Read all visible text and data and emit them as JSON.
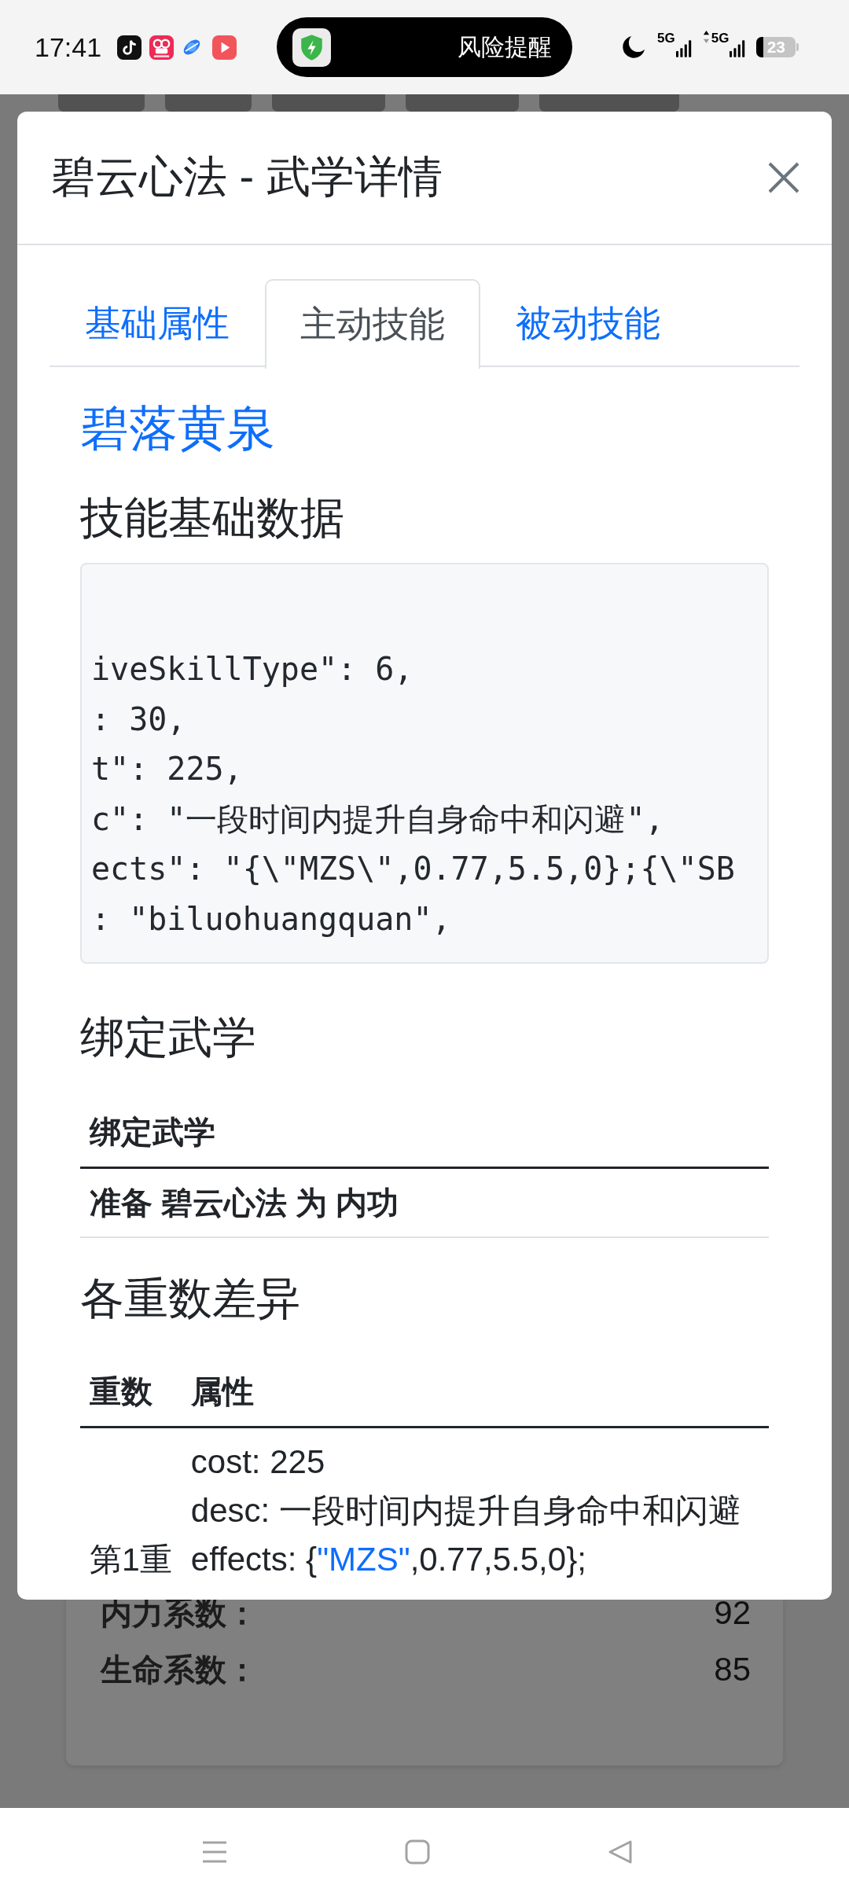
{
  "status_bar": {
    "time": "17:41",
    "notification": "风险提醒",
    "network": [
      "5G",
      "5G"
    ],
    "battery": "23"
  },
  "modal": {
    "title": "碧云心法 - 武学详情",
    "tabs": [
      {
        "label": "基础属性",
        "selected": false
      },
      {
        "label": "主动技能",
        "selected": true
      },
      {
        "label": "被动技能",
        "selected": false
      }
    ],
    "skill_name": "碧落黄泉",
    "base_data": {
      "heading": "技能基础数据",
      "code_lines": [
        "iveSkillType\": 6,",
        ": 30,",
        "t\": 225,",
        "c\": \"一段时间内提升自身命中和闪避\",",
        "ects\": \"{\\\"MZS\\\",0.77,5.5,0};{\\\"SB",
        ": \"biluohuangquan\","
      ]
    },
    "binding": {
      "heading": "绑定武学",
      "columns": [
        "绑定武学"
      ],
      "rows": [
        [
          "准备 碧云心法 为 内功"
        ]
      ]
    },
    "tiers": {
      "heading": "各重数差异",
      "columns": [
        "重数",
        "属性"
      ],
      "rows": [
        {
          "tier": "第1重",
          "attributes": [
            [
              {
                "kind": "plain",
                "text": "cost: 225"
              }
            ],
            [
              {
                "kind": "plain",
                "text": "desc: 一段时间内提升自身命中和闪避"
              }
            ],
            [
              {
                "kind": "plain",
                "text": "effects: {"
              },
              {
                "kind": "string",
                "text": "\"MZS\""
              },
              {
                "kind": "plain",
                "text": ",0.77,5.5,0};"
              }
            ]
          ]
        }
      ]
    }
  },
  "background": {
    "stats": [
      {
        "label": "内力系数：",
        "value": "92"
      },
      {
        "label": "生命系数：",
        "value": "85"
      }
    ]
  }
}
